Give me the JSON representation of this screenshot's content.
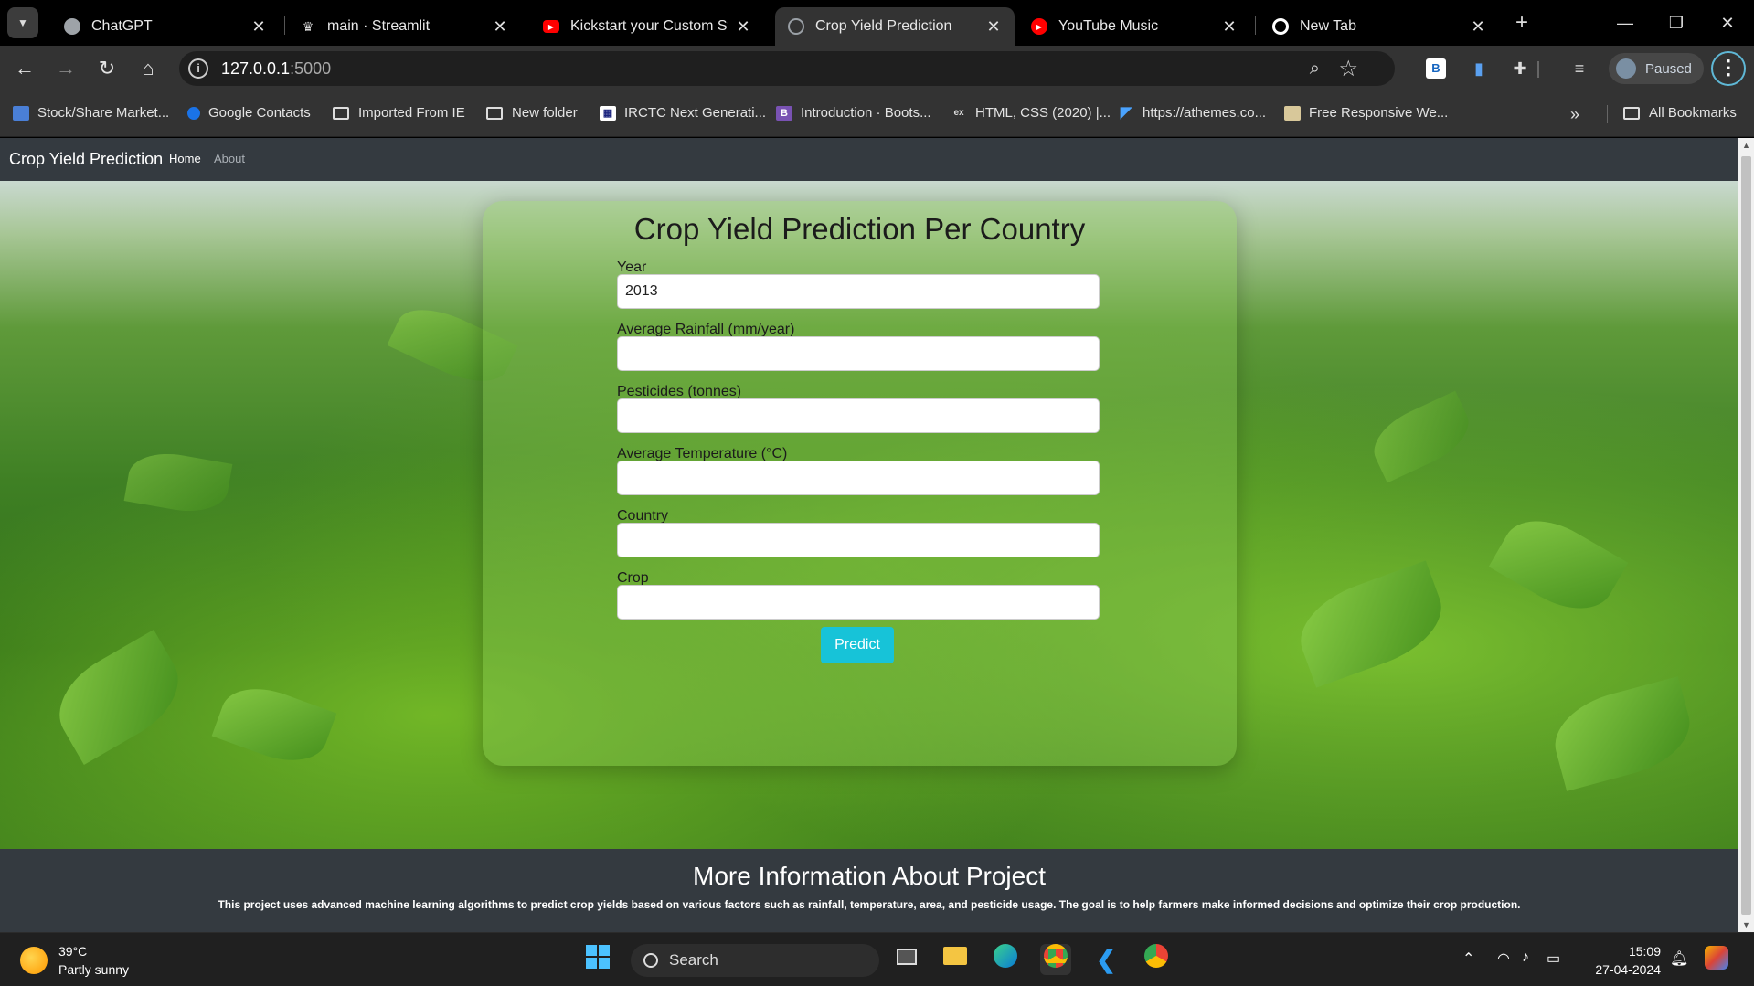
{
  "browser": {
    "tabs": [
      {
        "title": "ChatGPT",
        "icon": "chatgpt-icon",
        "color": "#9ea3a8",
        "active": false
      },
      {
        "title": "main · Streamlit",
        "icon": "streamlit-icon",
        "color": "#ff4b4b",
        "active": false
      },
      {
        "title": "Kickstart your Custom Stre",
        "icon": "youtube-icon",
        "color": "#ff0000",
        "active": false
      },
      {
        "title": "Crop Yield Prediction",
        "icon": "globe-icon",
        "color": "#9aa0a6",
        "active": true
      },
      {
        "title": "YouTube Music",
        "icon": "youtube-music-icon",
        "color": "#ff0000",
        "active": false
      },
      {
        "title": "New Tab",
        "icon": "chrome-icon",
        "color": "#ffffff",
        "active": false
      }
    ],
    "url_host": "127.0.0.1",
    "url_port": ":5000",
    "profile_label": "Paused",
    "bookmarks": [
      {
        "label": "Stock/Share Market...",
        "icon": "stock-icon"
      },
      {
        "label": "Google Contacts",
        "icon": "contacts-icon"
      },
      {
        "label": "Imported From IE",
        "icon": "folder-icon"
      },
      {
        "label": "New folder",
        "icon": "folder-icon"
      },
      {
        "label": "IRCTC Next Generati...",
        "icon": "irctc-icon"
      },
      {
        "label": "Introduction · Boots...",
        "icon": "bootstrap-icon"
      },
      {
        "label": "HTML, CSS (2020) |...",
        "icon": "edx-icon"
      },
      {
        "label": "https://athemes.co...",
        "icon": "athemes-icon"
      },
      {
        "label": "Free Responsive We...",
        "icon": "web-icon"
      }
    ],
    "all_bookmarks_label": "All Bookmarks"
  },
  "page": {
    "brand": "Crop Yield Prediction",
    "nav": [
      {
        "label": "Home",
        "active": true
      },
      {
        "label": "About",
        "active": false
      }
    ],
    "form": {
      "title": "Crop Yield Prediction Per Country",
      "fields": [
        {
          "label": "Year",
          "value": "2013"
        },
        {
          "label": "Average Rainfall (mm/year)",
          "value": ""
        },
        {
          "label": "Pesticides (tonnes)",
          "value": ""
        },
        {
          "label": "Average Temperature (°C)",
          "value": ""
        },
        {
          "label": "Country",
          "value": ""
        },
        {
          "label": "Crop",
          "value": ""
        }
      ],
      "submit_label": "Predict"
    },
    "info": {
      "heading": "More Information About Project",
      "text": "This project uses advanced machine learning algorithms to predict crop yields based on various factors such as rainfall, temperature, area, and pesticide usage. The goal is to help farmers make informed decisions and optimize their crop production."
    }
  },
  "taskbar": {
    "temperature": "39°C",
    "weather": "Partly sunny",
    "search_label": "Search",
    "time": "15:09",
    "date": "27-04-2024"
  },
  "colors": {
    "accent_button": "#17c3d8",
    "navbar": "#343a40"
  }
}
